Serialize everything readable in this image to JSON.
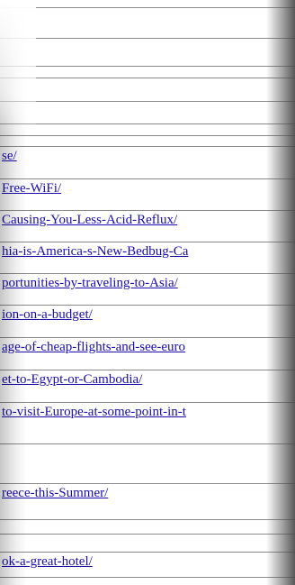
{
  "links": [
    "",
    "",
    "",
    "",
    "",
    "",
    "",
    "se/",
    "Free-WiFi/",
    "Causing-You-Less-Acid-Reflux/",
    "hia-is-America-s-New-Bedbug-Ca",
    "portunities-by-traveling-to-Asia/",
    "ion-on-a-budget/",
    "age-of-cheap-flights-and-see-euro",
    "et-to-Egypt-or-Cambodia/",
    "to-visit-Europe-at-some-point-in-t",
    "",
    "reece-this-Summer/",
    "",
    "",
    "ok-a-great-hotel/",
    ""
  ]
}
